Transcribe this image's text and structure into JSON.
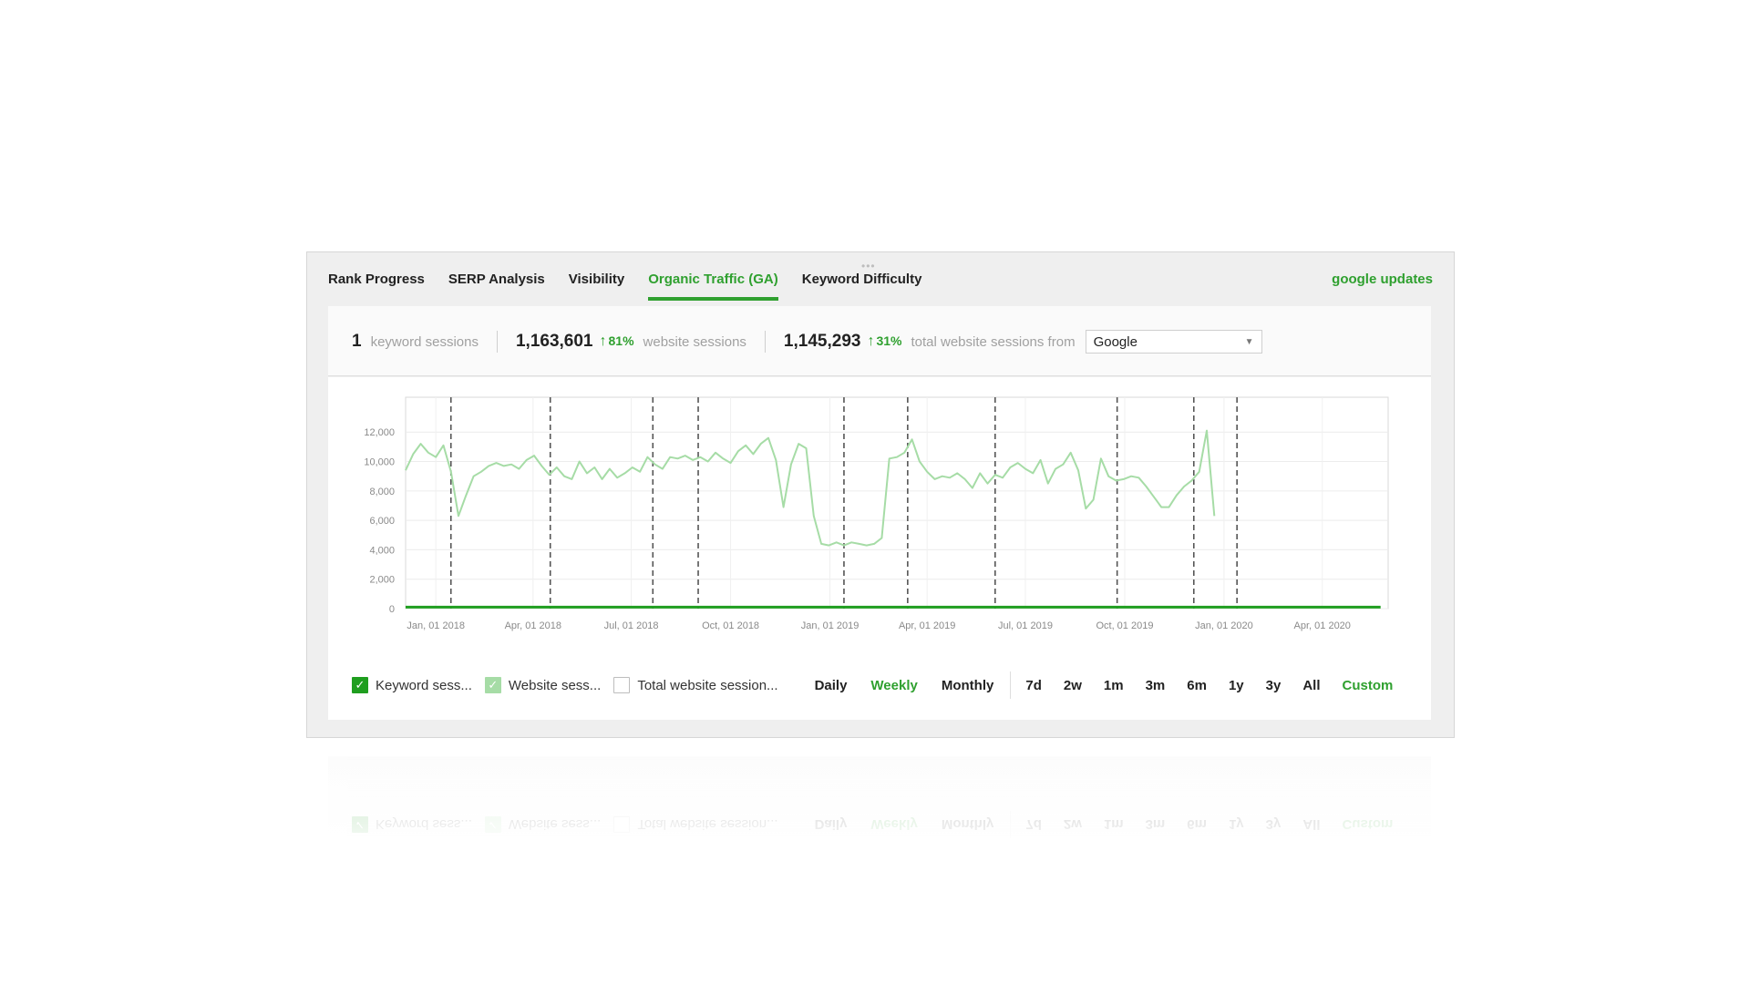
{
  "tabs": [
    {
      "label": "Rank Progress",
      "active": false
    },
    {
      "label": "SERP Analysis",
      "active": false
    },
    {
      "label": "Visibility",
      "active": false
    },
    {
      "label": "Organic Traffic (GA)",
      "active": true
    },
    {
      "label": "Keyword Difficulty",
      "active": false
    }
  ],
  "google_updates": "google updates",
  "stats": {
    "keyword_value": "1",
    "keyword_label": "keyword sessions",
    "website_value": "1,163,601",
    "website_change": "81%",
    "website_label": "website sessions",
    "total_value": "1,145,293",
    "total_change": "31%",
    "total_label": "total website sessions from",
    "source_select": "Google"
  },
  "legend": {
    "keyword": "Keyword sess...",
    "website": "Website sess...",
    "total": "Total website session..."
  },
  "periods": [
    "Daily",
    "Weekly",
    "Monthly"
  ],
  "active_period": "Weekly",
  "ranges": [
    "7d",
    "2w",
    "1m",
    "3m",
    "6m",
    "1y",
    "3y",
    "All",
    "Custom"
  ],
  "colors": {
    "accent": "#2fa02f",
    "keyword_series": "#1f9e1f",
    "website_series": "#a6dca6"
  },
  "chart_data": {
    "type": "line",
    "y_tick_labels": [
      "12,000",
      "10,000",
      "8,000",
      "6,000",
      "4,000",
      "2,000",
      "0"
    ],
    "y_ticks": [
      12000,
      10000,
      8000,
      6000,
      4000,
      2000,
      0
    ],
    "ylim": [
      0,
      13500
    ],
    "x_tick_labels": [
      "Jan, 01 2018",
      "Apr, 01 2018",
      "Jul, 01 2018",
      "Oct, 01 2018",
      "Jan, 01 2019",
      "Apr, 01 2019",
      "Jul, 01 2019",
      "Oct, 01 2019",
      "Jan, 01 2020",
      "Apr, 01 2020"
    ],
    "x_ticks": [
      "2018-01-01",
      "2018-04-01",
      "2018-07-01",
      "2018-10-01",
      "2019-01-01",
      "2019-04-01",
      "2019-07-01",
      "2019-10-01",
      "2020-01-01",
      "2020-04-01"
    ],
    "xlim": [
      "2017-12-04",
      "2020-06-01"
    ],
    "google_updates": [
      "2018-01-15",
      "2018-04-17",
      "2018-07-21",
      "2018-09-01",
      "2019-01-14",
      "2019-03-14",
      "2019-06-03",
      "2019-09-24",
      "2019-12-04",
      "2020-01-13"
    ],
    "series": [
      {
        "name": "Keyword sess...",
        "color": "#1f9e1f",
        "points": [
          [
            "2017-12-04",
            100
          ],
          [
            "2020-05-25",
            100
          ]
        ]
      },
      {
        "name": "Website sess...",
        "color": "#a6dca6",
        "points": [
          [
            "2017-12-04",
            9400
          ],
          [
            "2017-12-11",
            10500
          ],
          [
            "2017-12-18",
            11200
          ],
          [
            "2017-12-25",
            10600
          ],
          [
            "2018-01-01",
            10300
          ],
          [
            "2018-01-08",
            11100
          ],
          [
            "2018-01-15",
            9300
          ],
          [
            "2018-01-22",
            6300
          ],
          [
            "2018-01-29",
            7700
          ],
          [
            "2018-02-05",
            9000
          ],
          [
            "2018-02-12",
            9300
          ],
          [
            "2018-02-19",
            9700
          ],
          [
            "2018-02-26",
            9900
          ],
          [
            "2018-03-05",
            9700
          ],
          [
            "2018-03-12",
            9800
          ],
          [
            "2018-03-19",
            9500
          ],
          [
            "2018-03-26",
            10100
          ],
          [
            "2018-04-02",
            10400
          ],
          [
            "2018-04-09",
            9700
          ],
          [
            "2018-04-16",
            9100
          ],
          [
            "2018-04-23",
            9600
          ],
          [
            "2018-04-30",
            9000
          ],
          [
            "2018-05-07",
            8800
          ],
          [
            "2018-05-14",
            10000
          ],
          [
            "2018-05-21",
            9200
          ],
          [
            "2018-05-28",
            9600
          ],
          [
            "2018-06-04",
            8800
          ],
          [
            "2018-06-11",
            9500
          ],
          [
            "2018-06-18",
            8900
          ],
          [
            "2018-06-25",
            9200
          ],
          [
            "2018-07-02",
            9600
          ],
          [
            "2018-07-09",
            9300
          ],
          [
            "2018-07-16",
            10300
          ],
          [
            "2018-07-23",
            9800
          ],
          [
            "2018-07-30",
            9500
          ],
          [
            "2018-08-06",
            10300
          ],
          [
            "2018-08-13",
            10200
          ],
          [
            "2018-08-20",
            10400
          ],
          [
            "2018-08-27",
            10100
          ],
          [
            "2018-09-03",
            10300
          ],
          [
            "2018-09-10",
            10000
          ],
          [
            "2018-09-17",
            10600
          ],
          [
            "2018-09-24",
            10200
          ],
          [
            "2018-10-01",
            9900
          ],
          [
            "2018-10-08",
            10700
          ],
          [
            "2018-10-15",
            11100
          ],
          [
            "2018-10-22",
            10500
          ],
          [
            "2018-10-29",
            11200
          ],
          [
            "2018-11-05",
            11600
          ],
          [
            "2018-11-12",
            10100
          ],
          [
            "2018-11-19",
            6900
          ],
          [
            "2018-11-26",
            9800
          ],
          [
            "2018-12-03",
            11200
          ],
          [
            "2018-12-10",
            10900
          ],
          [
            "2018-12-17",
            6300
          ],
          [
            "2018-12-24",
            4400
          ],
          [
            "2018-12-31",
            4300
          ],
          [
            "2019-01-07",
            4500
          ],
          [
            "2019-01-14",
            4300
          ],
          [
            "2019-01-21",
            4500
          ],
          [
            "2019-01-28",
            4400
          ],
          [
            "2019-02-04",
            4300
          ],
          [
            "2019-02-11",
            4400
          ],
          [
            "2019-02-18",
            4800
          ],
          [
            "2019-02-25",
            10200
          ],
          [
            "2019-03-04",
            10300
          ],
          [
            "2019-03-11",
            10600
          ],
          [
            "2019-03-18",
            11500
          ],
          [
            "2019-03-25",
            10000
          ],
          [
            "2019-04-01",
            9300
          ],
          [
            "2019-04-08",
            8800
          ],
          [
            "2019-04-15",
            9000
          ],
          [
            "2019-04-22",
            8900
          ],
          [
            "2019-04-29",
            9200
          ],
          [
            "2019-05-06",
            8800
          ],
          [
            "2019-05-13",
            8200
          ],
          [
            "2019-05-20",
            9200
          ],
          [
            "2019-05-27",
            8500
          ],
          [
            "2019-06-03",
            9100
          ],
          [
            "2019-06-10",
            8900
          ],
          [
            "2019-06-17",
            9600
          ],
          [
            "2019-06-24",
            9900
          ],
          [
            "2019-07-01",
            9500
          ],
          [
            "2019-07-08",
            9200
          ],
          [
            "2019-07-15",
            10100
          ],
          [
            "2019-07-22",
            8500
          ],
          [
            "2019-07-29",
            9500
          ],
          [
            "2019-08-05",
            9800
          ],
          [
            "2019-08-12",
            10600
          ],
          [
            "2019-08-19",
            9400
          ],
          [
            "2019-08-26",
            6800
          ],
          [
            "2019-09-02",
            7400
          ],
          [
            "2019-09-09",
            10200
          ],
          [
            "2019-09-16",
            9000
          ],
          [
            "2019-09-23",
            8700
          ],
          [
            "2019-09-30",
            8800
          ],
          [
            "2019-10-07",
            9000
          ],
          [
            "2019-10-14",
            8900
          ],
          [
            "2019-10-21",
            8300
          ],
          [
            "2019-10-28",
            7600
          ],
          [
            "2019-11-04",
            6900
          ],
          [
            "2019-11-11",
            6900
          ],
          [
            "2019-11-18",
            7700
          ],
          [
            "2019-11-25",
            8300
          ],
          [
            "2019-12-02",
            8700
          ],
          [
            "2019-12-09",
            9300
          ],
          [
            "2019-12-16",
            12100
          ],
          [
            "2019-12-23",
            6300
          ]
        ]
      }
    ],
    "grid": true
  }
}
